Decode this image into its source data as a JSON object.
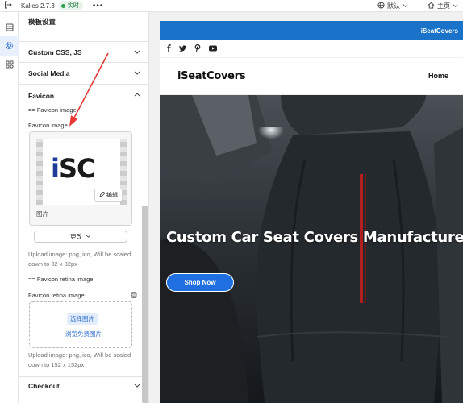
{
  "topbar": {
    "app_title": "Kalles 2.7.3",
    "status_badge": "实时",
    "more": "•••",
    "language": "默认",
    "home": "主页"
  },
  "panel": {
    "title": "模板设置",
    "sections": {
      "custom_css": "Custom CSS, JS",
      "social_media": "Social Media",
      "favicon": "Favicon",
      "checkout": "Checkout"
    },
    "favicon_heading": "== Favicon image",
    "favicon_image_label": "Favicon image",
    "image_caption": "图片",
    "edit_button": "编辑",
    "change_button": "更改",
    "favicon_help": "Upload image: png, ico, Will be scaled down to 32 x 32px",
    "retina_heading": "== Favicon retina image",
    "retina_label": "Favicon retina image",
    "select_image": "选择图片",
    "browse_free": "浏览免费图片",
    "retina_help": "Upload image: png, ico, Will be scaled down to 152 x 152px",
    "logo_text_i": "i",
    "logo_text_rest": "SC"
  },
  "preview": {
    "announcement": "iSeatCovers",
    "brand": "iSeatCovers",
    "nav_home": "Home",
    "hero_title": "Custom Car Seat Covers Manufacturer",
    "hero_button": "Shop Now"
  },
  "colors": {
    "announcement_bg": "#1a73c9",
    "accent": "#2c6ecb",
    "shop_button": "#1f6fe0",
    "annotation_arrow": "#e53935"
  }
}
